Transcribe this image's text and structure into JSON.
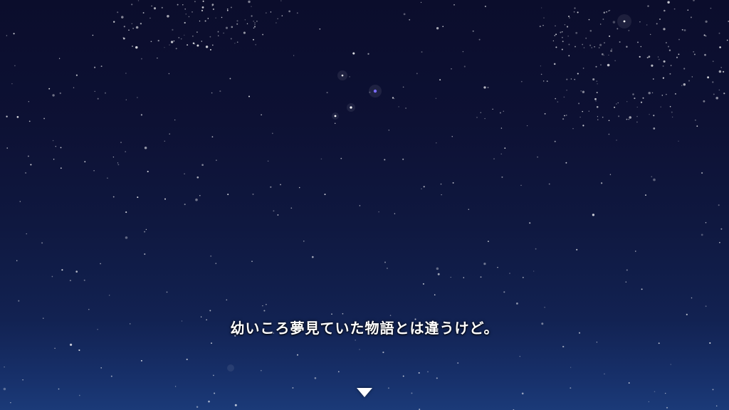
{
  "scene": {
    "background": "night-sky-starfield",
    "sky_colors": [
      "#0b0d2c",
      "#0f1840",
      "#1b3a78"
    ],
    "star_color": "#ffffff",
    "accent_star_color": "#7a6cff"
  },
  "dialogue": {
    "text": "幼いころ夢見ていた物語とは違うけど。"
  },
  "advance_indicator": {
    "icon": "triangle-down-icon"
  }
}
